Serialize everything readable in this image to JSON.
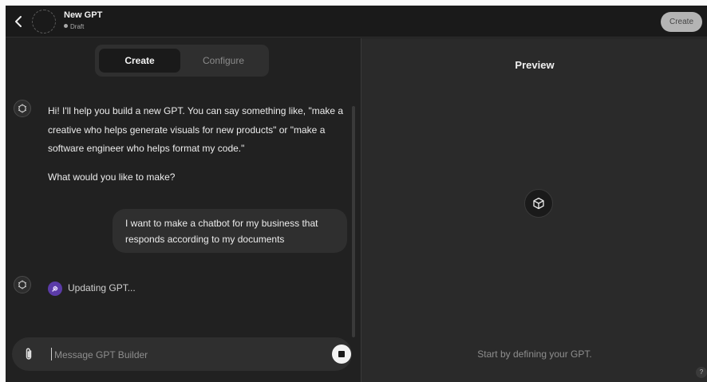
{
  "header": {
    "title": "New GPT",
    "status": "Draft",
    "create_label": "Create",
    "back_icon": "chevron-left-icon"
  },
  "tabs": [
    {
      "label": "Create",
      "active": true
    },
    {
      "label": "Configure",
      "active": false
    }
  ],
  "chat": {
    "bot_intro": "Hi! I'll help you build a new GPT. You can say something like, \"make a creative who helps generate visuals for new products\" or \"make a software engineer who helps format my code.\"",
    "bot_question": "What would you like to make?",
    "user_message": "I want to make a chatbot for my business that responds according to my documents",
    "status_text": "Updating GPT..."
  },
  "composer": {
    "placeholder": "Message GPT Builder"
  },
  "preview": {
    "title": "Preview",
    "hint": "Start by defining your GPT.",
    "help_label": "?"
  },
  "colors": {
    "background": "#212121",
    "preview_background": "#2a2a2a",
    "accent_purple": "#5b3ba8"
  }
}
